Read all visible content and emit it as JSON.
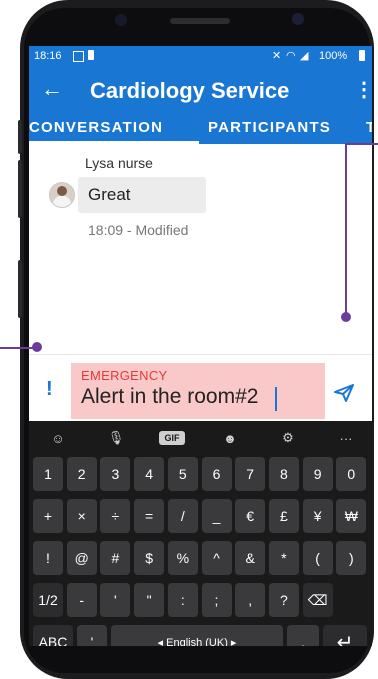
{
  "status": {
    "time": "18:16",
    "battery": "100%"
  },
  "appbar": {
    "title": "Cardiology Service"
  },
  "tabs": [
    {
      "label": "CONVERSATION",
      "active": true
    },
    {
      "label": "PARTICIPANTS",
      "active": false
    },
    {
      "label": "T",
      "active": false
    }
  ],
  "message": {
    "sender": "Lysa nurse",
    "text": "Great",
    "meta": "18:09 - Modified"
  },
  "compose": {
    "priority_mark": "!",
    "priority_label": "EMERGENCY",
    "text": "Alert in the room#2"
  },
  "keyboard": {
    "top_icons": [
      "emoji-icon",
      "mic-icon",
      "gif-icon",
      "smiley-icon",
      "settings-icon",
      "more-icon"
    ],
    "top_labels": {
      "gif": "GIF",
      "more": "···"
    },
    "rows": [
      [
        "1",
        "2",
        "3",
        "4",
        "5",
        "6",
        "7",
        "8",
        "9",
        "0"
      ],
      [
        "+",
        "×",
        "÷",
        "=",
        "/",
        "_",
        "€",
        "£",
        "¥",
        "₩"
      ],
      [
        "!",
        "@",
        "#",
        "$",
        "%",
        "^",
        "&",
        "*",
        "(",
        ")"
      ],
      [
        "1/2",
        "-",
        "'",
        "\"",
        ":",
        ";",
        ",",
        "?",
        "⌫"
      ]
    ],
    "bottom": {
      "abc": "ABC",
      "apostrophe": "'",
      "space": "◂ English (UK) ▸",
      "period": ".",
      "enter": "↵"
    }
  },
  "colors": {
    "primary": "#1976d2",
    "emergency": "#e53935",
    "emergency_bg": "#f9c9c9",
    "annotation": "#6a3d9a"
  }
}
